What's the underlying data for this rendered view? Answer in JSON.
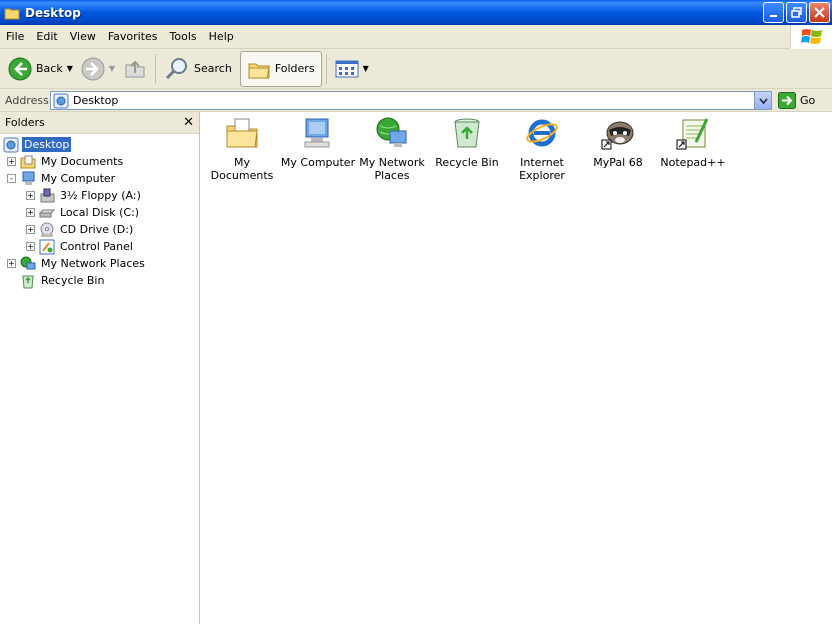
{
  "window": {
    "title": "Desktop"
  },
  "menu": [
    "File",
    "Edit",
    "View",
    "Favorites",
    "Tools",
    "Help"
  ],
  "toolbar": {
    "back": "Back",
    "search": "Search",
    "folders": "Folders"
  },
  "address": {
    "label": "Address",
    "value": "Desktop",
    "go": "Go"
  },
  "folders_pane": {
    "title": "Folders",
    "tree": [
      {
        "label": "Desktop",
        "icon": "desktop-icon",
        "level": 0,
        "expander": "",
        "selected": true
      },
      {
        "label": "My Documents",
        "icon": "my-documents-icon",
        "level": 1,
        "expander": "+"
      },
      {
        "label": "My Computer",
        "icon": "my-computer-icon",
        "level": 1,
        "expander": "-"
      },
      {
        "label": "3½ Floppy (A:)",
        "icon": "floppy-icon",
        "level": 2,
        "expander": "+"
      },
      {
        "label": "Local Disk (C:)",
        "icon": "hard-disk-icon",
        "level": 2,
        "expander": "+"
      },
      {
        "label": "CD Drive (D:)",
        "icon": "cd-drive-icon",
        "level": 2,
        "expander": "+"
      },
      {
        "label": "Control Panel",
        "icon": "control-panel-icon",
        "level": 2,
        "expander": "+"
      },
      {
        "label": "My Network Places",
        "icon": "network-places-icon",
        "level": 1,
        "expander": "+"
      },
      {
        "label": "Recycle Bin",
        "icon": "recycle-bin-icon",
        "level": 1,
        "expander": ""
      }
    ]
  },
  "content_items": [
    {
      "label": "My Documents",
      "icon": "my-documents-icon"
    },
    {
      "label": "My Computer",
      "icon": "my-computer-icon"
    },
    {
      "label": "My Network Places",
      "icon": "network-places-icon"
    },
    {
      "label": "Recycle Bin",
      "icon": "recycle-bin-icon"
    },
    {
      "label": "Internet Explorer",
      "icon": "internet-explorer-icon"
    },
    {
      "label": "MyPal 68",
      "icon": "mypal-icon"
    },
    {
      "label": "Notepad++",
      "icon": "notepad-plus-plus-icon"
    }
  ],
  "colors": {
    "titlebar": "#0058e0",
    "selection": "#316ac5",
    "chrome": "#ece9d8"
  }
}
